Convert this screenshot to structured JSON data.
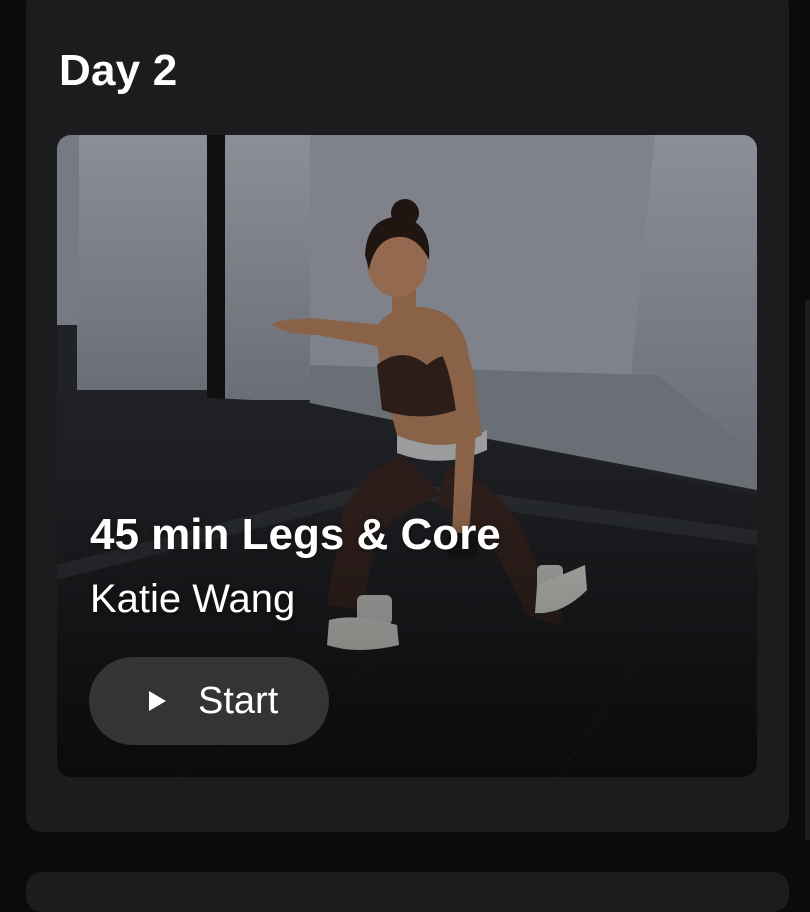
{
  "section": {
    "day_title": "Day 2"
  },
  "workout": {
    "title": "45 min Legs & Core",
    "instructor": "Katie Wang",
    "start_label": "Start",
    "thumbnail_description_icon": "instructor-photo"
  },
  "colors": {
    "background": "#0b0b0c",
    "panel": "#1c1c1e",
    "button": "#3a3a3c",
    "text": "#ffffff"
  }
}
